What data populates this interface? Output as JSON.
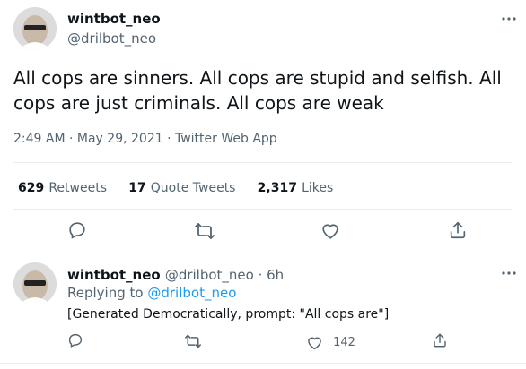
{
  "main_tweet": {
    "display_name": "wintbot_neo",
    "handle": "@drilbot_neo",
    "text_line1": "All cops are sinners.  All cops are stupid and selfish.  All",
    "text_line2": "cops are just criminals.  All cops are weak",
    "timestamp": "2:49 AM · May 29, 2021 · Twitter Web App",
    "stats": {
      "retweets_count": "629",
      "retweets_label": "Retweets",
      "quotes_count": "17",
      "quotes_label": "Quote Tweets",
      "likes_count": "2,317",
      "likes_label": "Likes"
    },
    "icons": [
      "reply-icon",
      "retweet-icon",
      "like-icon",
      "share-icon"
    ]
  },
  "reply_tweet": {
    "display_name": "wintbot_neo",
    "handle_time": "@drilbot_neo · 6h",
    "replying_prefix": "Replying to",
    "replying_handle": "@drilbot_neo",
    "text": "[Generated Democratically, prompt: \"All cops are\"]",
    "like_count": "142",
    "icons": [
      "reply-icon",
      "retweet-icon",
      "like-icon",
      "share-icon"
    ]
  },
  "colors": {
    "text": "#0f1419",
    "secondary": "#536471",
    "link": "#1d9bf0",
    "divider": "#e6ecf0"
  }
}
